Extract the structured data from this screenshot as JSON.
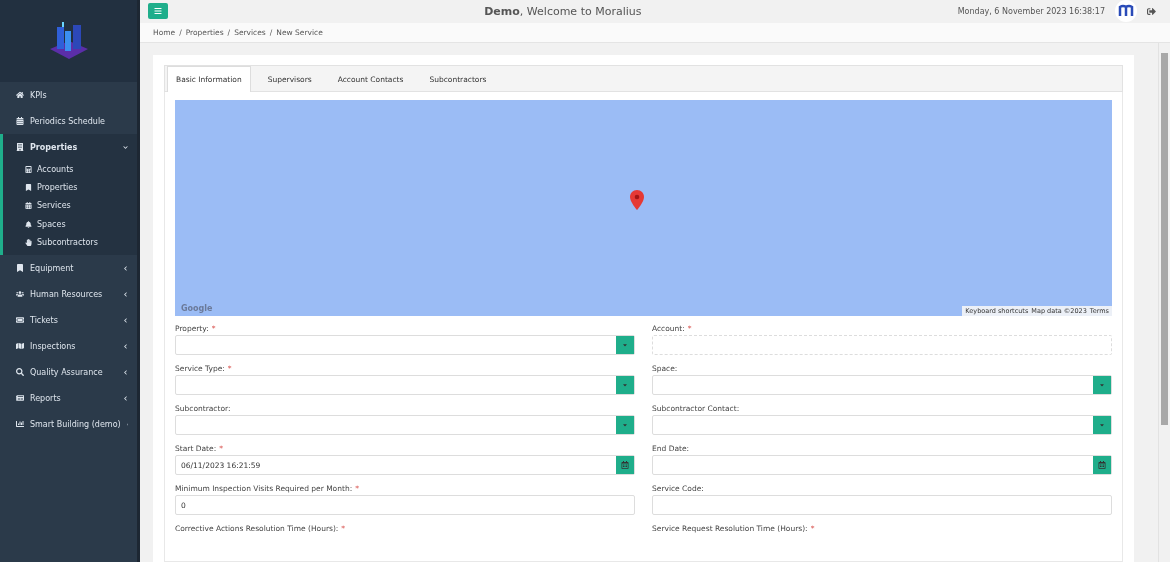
{
  "sidebar": {
    "items": [
      {
        "label": "KPIs",
        "has_submenu": false,
        "selected": false
      },
      {
        "label": "Periodics Schedule",
        "has_submenu": false,
        "selected": false
      },
      {
        "label": "Properties",
        "has_submenu": true,
        "expanded": true,
        "selected": true,
        "children": [
          {
            "label": "Accounts"
          },
          {
            "label": "Properties"
          },
          {
            "label": "Services"
          },
          {
            "label": "Spaces"
          },
          {
            "label": "Subcontractors"
          }
        ]
      },
      {
        "label": "Equipment",
        "has_submenu": true,
        "expanded": false,
        "selected": false
      },
      {
        "label": "Human Resources",
        "has_submenu": true,
        "expanded": false,
        "selected": false
      },
      {
        "label": "Tickets",
        "has_submenu": true,
        "expanded": false,
        "selected": false
      },
      {
        "label": "Inspections",
        "has_submenu": true,
        "expanded": false,
        "selected": false
      },
      {
        "label": "Quality Assurance",
        "has_submenu": true,
        "expanded": false,
        "selected": false
      },
      {
        "label": "Reports",
        "has_submenu": true,
        "expanded": false,
        "selected": false
      },
      {
        "label": "Smart Building (demo)",
        "has_submenu": true,
        "expanded": false,
        "selected": false
      }
    ]
  },
  "header": {
    "title": "**Demo**, Welcome to Moralius",
    "datetime": "Monday, 6 November 2023 16:38:17"
  },
  "breadcrumb": {
    "separator": "/",
    "items": [
      "Home",
      "Properties",
      "Services",
      "New Service"
    ]
  },
  "tabs": [
    {
      "label": "Basic Information",
      "selected": true
    },
    {
      "label": "Supervisors",
      "selected": false
    },
    {
      "label": "Account Contacts",
      "selected": false
    },
    {
      "label": "Subcontractors",
      "selected": false
    }
  ],
  "map": {
    "logo": "Google",
    "footer": [
      "Keyboard shortcuts",
      "Map data ©2023",
      "Terms"
    ]
  },
  "fields": [
    {
      "label": "Property:",
      "required_mark": "*",
      "kind": "select"
    },
    {
      "label": "Account:",
      "required_mark": "*",
      "kind": "readonly"
    },
    {
      "label": "Service Type:",
      "required_mark": "*",
      "kind": "select"
    },
    {
      "label": "Space:",
      "kind": "select"
    },
    {
      "label": "Subcontractor:",
      "kind": "select"
    },
    {
      "label": "Subcontractor Contact:",
      "kind": "select"
    },
    {
      "label": "Start Date:",
      "required_mark": "*",
      "kind": "date",
      "value": "06/11/2023 16:21:59"
    },
    {
      "label": "End Date:",
      "kind": "date"
    },
    {
      "label": "Minimum Inspection Visits Required per Month:",
      "required_mark": "*",
      "kind": "text",
      "value": "0"
    },
    {
      "label": "Service Code:",
      "kind": "text"
    },
    {
      "label": "Corrective Actions Resolution Time (Hours):",
      "required_mark": "*",
      "kind": "label"
    },
    {
      "label": "Service Request Resolution Time (Hours):",
      "required_mark": "*",
      "kind": "label"
    }
  ]
}
